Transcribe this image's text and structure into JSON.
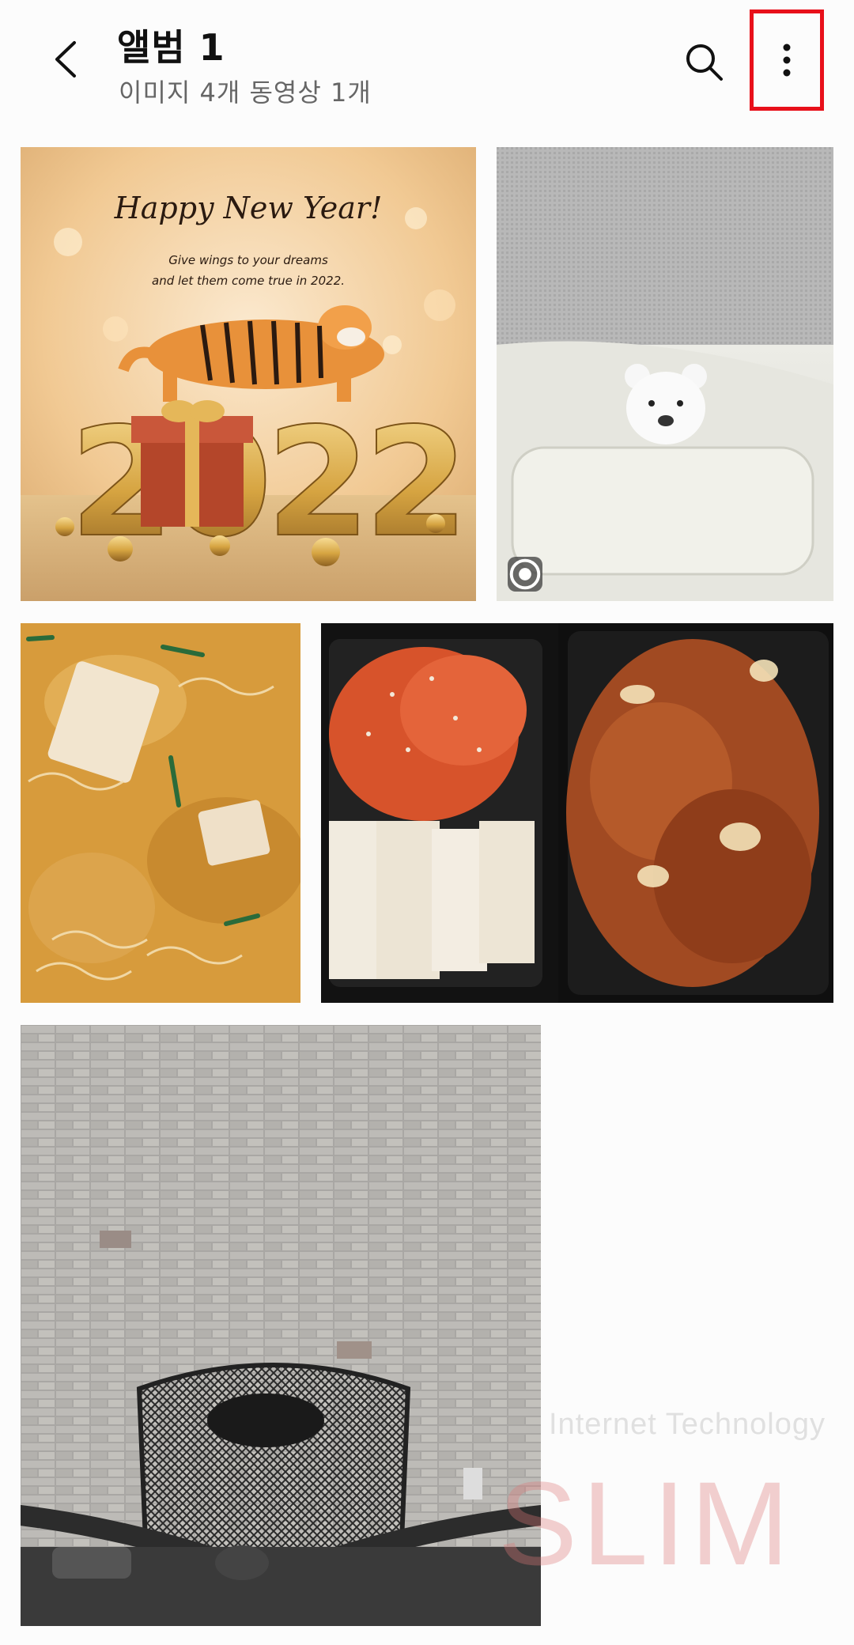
{
  "header": {
    "title": "앨범 1",
    "subtitle": "이미지 4개 동영상 1개",
    "back_icon": "chevron-left-icon",
    "search_icon": "search-icon",
    "more_icon": "more-vertical-icon",
    "highlight_color": "#e8101a"
  },
  "thumbnails": [
    {
      "kind": "image",
      "greeting": "Happy New Year!",
      "line1": "Give wings to your dreams",
      "line2": "and let them come true in 2022.",
      "year": "2022"
    },
    {
      "kind": "video",
      "badge_icon": "video-play-icon"
    },
    {
      "kind": "image"
    },
    {
      "kind": "image"
    },
    {
      "kind": "image"
    }
  ],
  "watermark": {
    "tagline": "Internet Technology",
    "brand": "SLIM"
  }
}
